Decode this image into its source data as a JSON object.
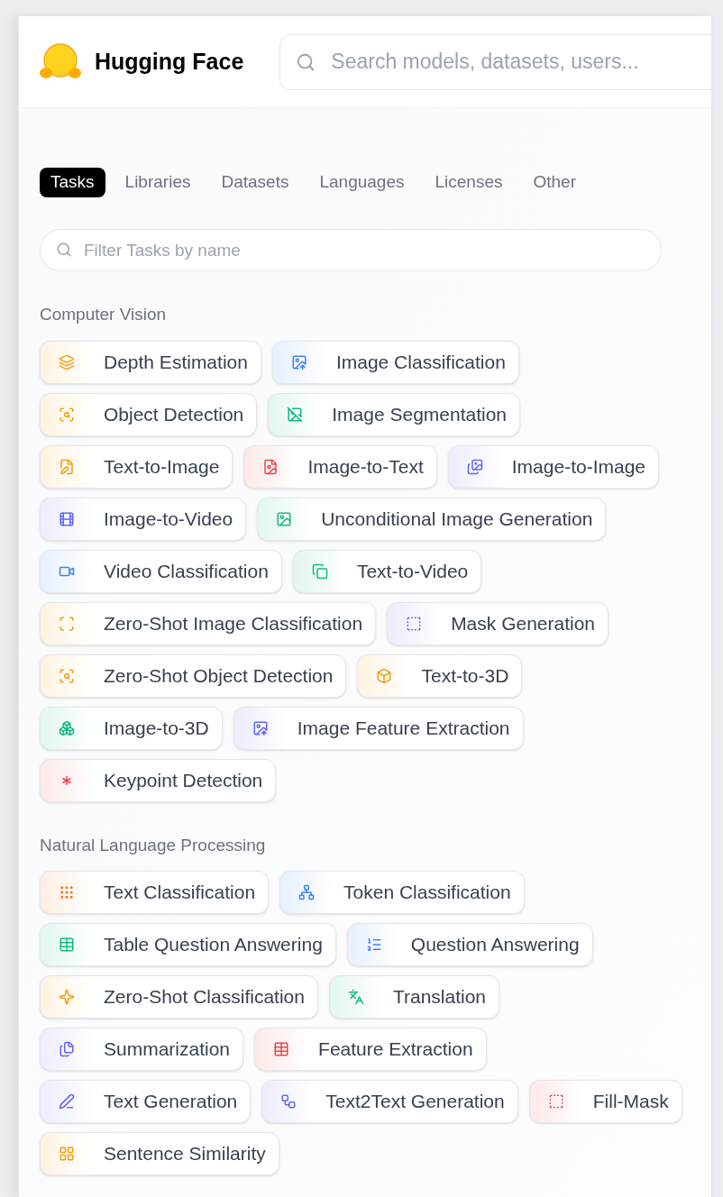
{
  "header": {
    "brand": "Hugging Face",
    "search": {
      "placeholder": "Search models, datasets, users..."
    }
  },
  "tabs": [
    {
      "label": "Tasks",
      "selected": true
    },
    {
      "label": "Libraries",
      "selected": false
    },
    {
      "label": "Datasets",
      "selected": false
    },
    {
      "label": "Languages",
      "selected": false
    },
    {
      "label": "Licenses",
      "selected": false
    },
    {
      "label": "Other",
      "selected": false
    }
  ],
  "filter": {
    "placeholder": "Filter Tasks by name"
  },
  "sections": [
    {
      "title": "Computer Vision",
      "tasks": [
        {
          "label": "Depth Estimation",
          "color": "#f59e0b"
        },
        {
          "label": "Image Classification",
          "color": "#3b82f6"
        },
        {
          "label": "Object Detection",
          "color": "#f59e0b"
        },
        {
          "label": "Image Segmentation",
          "color": "#10b981"
        },
        {
          "label": "Text-to-Image",
          "color": "#f59e0b"
        },
        {
          "label": "Image-to-Text",
          "color": "#ef4444"
        },
        {
          "label": "Image-to-Image",
          "color": "#6366f1"
        },
        {
          "label": "Image-to-Video",
          "color": "#6366f1"
        },
        {
          "label": "Unconditional Image Generation",
          "color": "#10b981"
        },
        {
          "label": "Video Classification",
          "color": "#3b82f6"
        },
        {
          "label": "Text-to-Video",
          "color": "#10b981"
        },
        {
          "label": "Zero-Shot Image Classification",
          "color": "#f59e0b"
        },
        {
          "label": "Mask Generation",
          "color": "#6366f1"
        },
        {
          "label": "Zero-Shot Object Detection",
          "color": "#f59e0b"
        },
        {
          "label": "Text-to-3D",
          "color": "#f59e0b"
        },
        {
          "label": "Image-to-3D",
          "color": "#10b981"
        },
        {
          "label": "Image Feature Extraction",
          "color": "#6366f1"
        },
        {
          "label": "Keypoint Detection",
          "color": "#ef4444"
        }
      ]
    },
    {
      "title": "Natural Language Processing",
      "tasks": [
        {
          "label": "Text Classification",
          "color": "#f97316"
        },
        {
          "label": "Token Classification",
          "color": "#3b82f6"
        },
        {
          "label": "Table Question Answering",
          "color": "#10b981"
        },
        {
          "label": "Question Answering",
          "color": "#3b82f6"
        },
        {
          "label": "Zero-Shot Classification",
          "color": "#f59e0b"
        },
        {
          "label": "Translation",
          "color": "#10b981"
        },
        {
          "label": "Summarization",
          "color": "#6366f1"
        },
        {
          "label": "Feature Extraction",
          "color": "#ef4444"
        },
        {
          "label": "Text Generation",
          "color": "#6366f1"
        },
        {
          "label": "Text2Text Generation",
          "color": "#6366f1"
        },
        {
          "label": "Fill-Mask",
          "color": "#ef4444"
        },
        {
          "label": "Sentence Similarity",
          "color": "#f59e0b"
        }
      ]
    }
  ]
}
